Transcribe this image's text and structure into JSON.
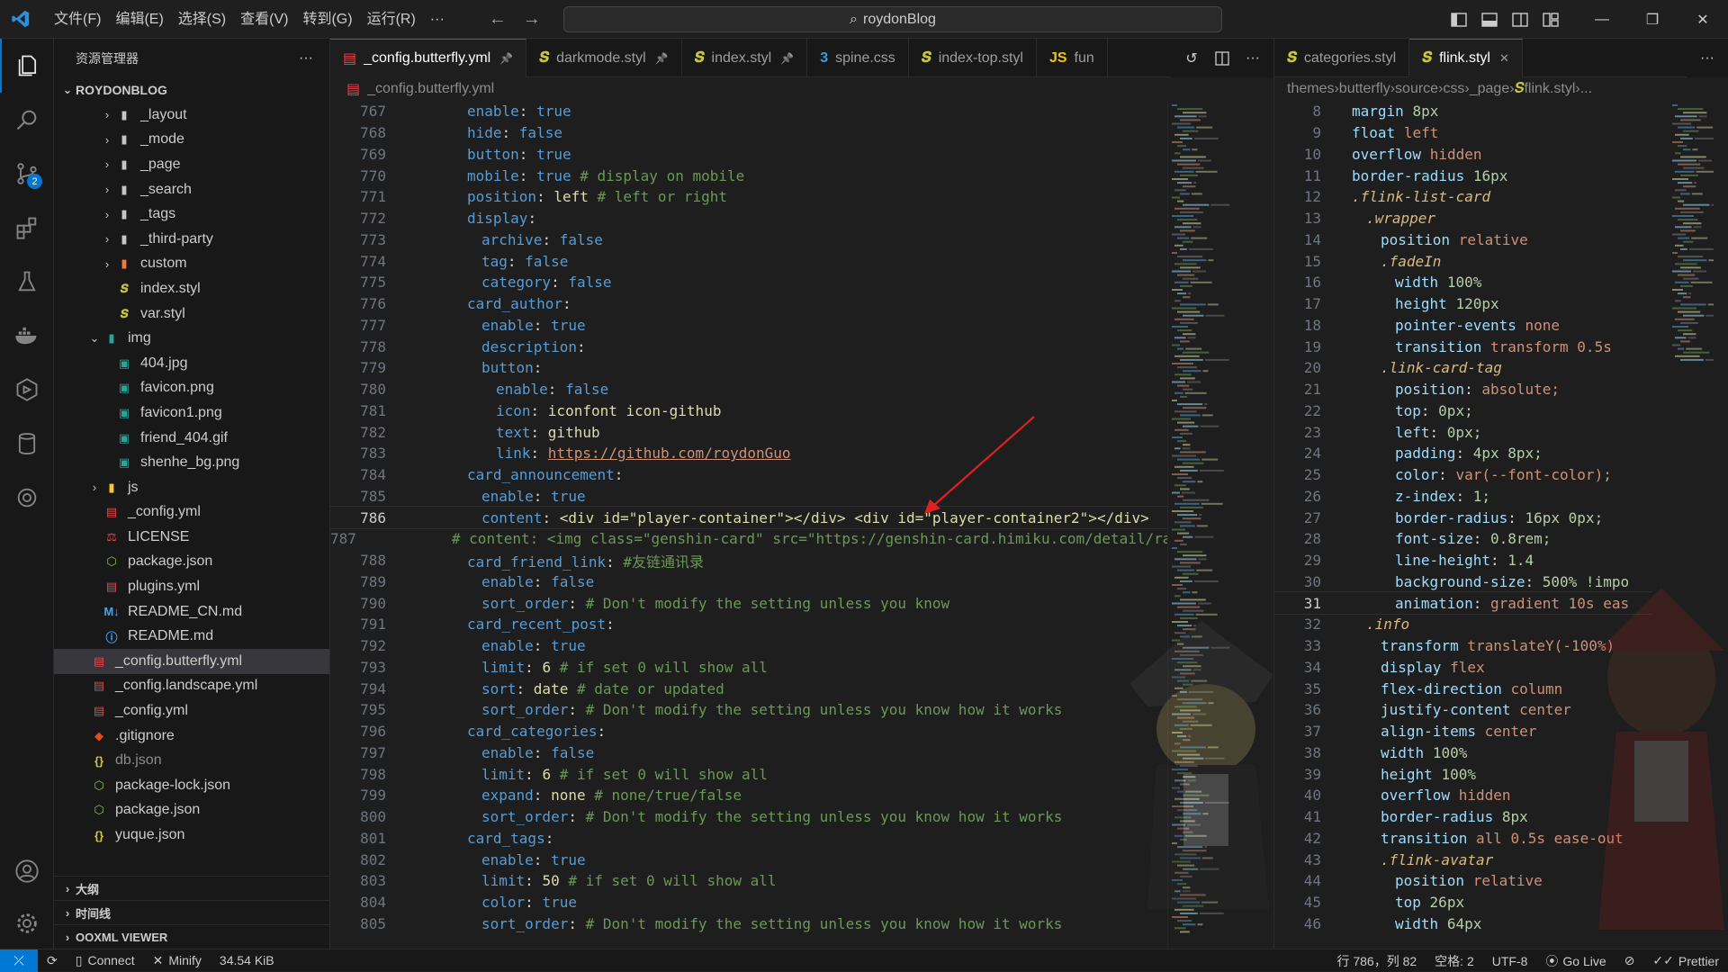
{
  "title_bar": {
    "menus": [
      "文件(F)",
      "编辑(E)",
      "选择(S)",
      "查看(V)",
      "转到(G)",
      "运行(R)",
      "···"
    ],
    "search_text": "roydonBlog"
  },
  "activity_bar": {
    "source_control_badge": "2"
  },
  "sidebar": {
    "header": "资源管理器",
    "more": "···",
    "root": "ROYDONBLOG",
    "items": [
      {
        "label": "_layout",
        "type": "folder",
        "depth": 2,
        "expanded": false
      },
      {
        "label": "_mode",
        "type": "folder",
        "depth": 2,
        "expanded": false
      },
      {
        "label": "_page",
        "type": "folder",
        "depth": 2,
        "expanded": false
      },
      {
        "label": "_search",
        "type": "folder",
        "depth": 2,
        "expanded": false
      },
      {
        "label": "_tags",
        "type": "folder",
        "depth": 2,
        "expanded": false
      },
      {
        "label": "_third-party",
        "type": "folder",
        "depth": 2,
        "expanded": false
      },
      {
        "label": "custom",
        "type": "folder-custom",
        "depth": 2,
        "expanded": false
      },
      {
        "label": "index.styl",
        "type": "styl",
        "depth": 2
      },
      {
        "label": "var.styl",
        "type": "styl",
        "depth": 2
      },
      {
        "label": "img",
        "type": "folder-img",
        "depth": 1,
        "expanded": true
      },
      {
        "label": "404.jpg",
        "type": "image",
        "depth": 2
      },
      {
        "label": "favicon.png",
        "type": "image",
        "depth": 2
      },
      {
        "label": "favicon1.png",
        "type": "image",
        "depth": 2
      },
      {
        "label": "friend_404.gif",
        "type": "image",
        "depth": 2
      },
      {
        "label": "shenhe_bg.png",
        "type": "image",
        "depth": 2
      },
      {
        "label": "js",
        "type": "folder-js",
        "depth": 1,
        "expanded": false
      },
      {
        "label": "_config.yml",
        "type": "yml",
        "depth": 1
      },
      {
        "label": "LICENSE",
        "type": "license",
        "depth": 1
      },
      {
        "label": "package.json",
        "type": "json-node",
        "depth": 1
      },
      {
        "label": "plugins.yml",
        "type": "yml",
        "depth": 1
      },
      {
        "label": "README_CN.md",
        "type": "md",
        "depth": 1
      },
      {
        "label": "README.md",
        "type": "info",
        "depth": 1
      },
      {
        "label": "_config.butterfly.yml",
        "type": "yml",
        "depth": 0,
        "selected": true
      },
      {
        "label": "_config.landscape.yml",
        "type": "yml",
        "depth": 0
      },
      {
        "label": "_config.yml",
        "type": "yml",
        "depth": 0
      },
      {
        "label": ".gitignore",
        "type": "git",
        "depth": 0
      },
      {
        "label": "db.json",
        "type": "json",
        "depth": 0,
        "dim": true
      },
      {
        "label": "package-lock.json",
        "type": "json-node",
        "depth": 0
      },
      {
        "label": "package.json",
        "type": "json-node",
        "depth": 0
      },
      {
        "label": "yuque.json",
        "type": "json",
        "depth": 0
      }
    ],
    "sections": [
      "大纲",
      "时间线",
      "OOXML VIEWER"
    ]
  },
  "editor_left": {
    "tabs": [
      {
        "label": "_config.butterfly.yml",
        "icon": "yml",
        "active": true,
        "pinned": true
      },
      {
        "label": "darkmode.styl",
        "icon": "styl",
        "pinned": true
      },
      {
        "label": "index.styl",
        "icon": "styl",
        "pinned": true
      },
      {
        "label": "spine.css",
        "icon": "css"
      },
      {
        "label": "index-top.styl",
        "icon": "styl"
      },
      {
        "label": "fun",
        "icon": "js"
      }
    ],
    "breadcrumb": "_config.butterfly.yml",
    "current_line": 786,
    "lines": [
      {
        "n": 767,
        "ind": 0,
        "k": "enable",
        "v": "true",
        "c": ""
      },
      {
        "n": 768,
        "ind": 0,
        "k": "hide",
        "v": "false",
        "c": ""
      },
      {
        "n": 769,
        "ind": 0,
        "k": "button",
        "v": "true",
        "c": ""
      },
      {
        "n": 770,
        "ind": 0,
        "k": "mobile",
        "v": "true",
        "c": "# display on mobile"
      },
      {
        "n": 771,
        "ind": 0,
        "k": "position",
        "v": "left",
        "c": "# left or right"
      },
      {
        "n": 772,
        "ind": 0,
        "k": "display",
        "v": "",
        "c": ""
      },
      {
        "n": 773,
        "ind": 1,
        "k": "archive",
        "v": "false",
        "c": ""
      },
      {
        "n": 774,
        "ind": 1,
        "k": "tag",
        "v": "false",
        "c": ""
      },
      {
        "n": 775,
        "ind": 1,
        "k": "category",
        "v": "false",
        "c": ""
      },
      {
        "n": 776,
        "ind": 0,
        "k": "card_author",
        "v": "",
        "c": ""
      },
      {
        "n": 777,
        "ind": 1,
        "k": "enable",
        "v": "true",
        "c": ""
      },
      {
        "n": 778,
        "ind": 1,
        "k": "description",
        "v": "",
        "c": ""
      },
      {
        "n": 779,
        "ind": 1,
        "k": "button",
        "v": "",
        "c": ""
      },
      {
        "n": 780,
        "ind": 2,
        "k": "enable",
        "v": "false",
        "c": ""
      },
      {
        "n": 781,
        "ind": 2,
        "k": "icon",
        "v": "iconfont icon-github",
        "c": ""
      },
      {
        "n": 782,
        "ind": 2,
        "k": "text",
        "v": "github",
        "c": ""
      },
      {
        "n": 783,
        "ind": 2,
        "k": "link",
        "v": "https://github.com/roydonGuo",
        "c": "",
        "link": true
      },
      {
        "n": 784,
        "ind": 0,
        "k": "card_announcement",
        "v": "",
        "c": ""
      },
      {
        "n": 785,
        "ind": 1,
        "k": "enable",
        "v": "true",
        "c": ""
      },
      {
        "n": 786,
        "ind": 1,
        "k": "content",
        "v": "<div id=\"player-container\"></div> <div id=\"player-container2\"></div>",
        "c": ""
      },
      {
        "n": 787,
        "ind": 1,
        "k": "",
        "v": "",
        "c": "# content: <img class=\"genshin-card\" src=\"https://genshin-card.himiku.com/detail/ra"
      },
      {
        "n": 788,
        "ind": 0,
        "k": "card_friend_link",
        "v": "",
        "c": "#友链通讯录"
      },
      {
        "n": 789,
        "ind": 1,
        "k": "enable",
        "v": "false",
        "c": ""
      },
      {
        "n": 790,
        "ind": 1,
        "k": "sort_order",
        "v": "",
        "c": "# Don't modify the setting unless you know"
      },
      {
        "n": 791,
        "ind": 0,
        "k": "card_recent_post",
        "v": "",
        "c": ""
      },
      {
        "n": 792,
        "ind": 1,
        "k": "enable",
        "v": "true",
        "c": ""
      },
      {
        "n": 793,
        "ind": 1,
        "k": "limit",
        "v": "6",
        "c": "# if set 0 will show all"
      },
      {
        "n": 794,
        "ind": 1,
        "k": "sort",
        "v": "date",
        "c": "# date or updated"
      },
      {
        "n": 795,
        "ind": 1,
        "k": "sort_order",
        "v": "",
        "c": "# Don't modify the setting unless you know how it works"
      },
      {
        "n": 796,
        "ind": 0,
        "k": "card_categories",
        "v": "",
        "c": ""
      },
      {
        "n": 797,
        "ind": 1,
        "k": "enable",
        "v": "false",
        "c": ""
      },
      {
        "n": 798,
        "ind": 1,
        "k": "limit",
        "v": "6",
        "c": "# if set 0 will show all"
      },
      {
        "n": 799,
        "ind": 1,
        "k": "expand",
        "v": "none",
        "c": "# none/true/false"
      },
      {
        "n": 800,
        "ind": 1,
        "k": "sort_order",
        "v": "",
        "c": "# Don't modify the setting unless you know how it works"
      },
      {
        "n": 801,
        "ind": 0,
        "k": "card_tags",
        "v": "",
        "c": ""
      },
      {
        "n": 802,
        "ind": 1,
        "k": "enable",
        "v": "true",
        "c": ""
      },
      {
        "n": 803,
        "ind": 1,
        "k": "limit",
        "v": "50",
        "c": "# if set 0 will show all"
      },
      {
        "n": 804,
        "ind": 1,
        "k": "color",
        "v": "true",
        "c": ""
      },
      {
        "n": 805,
        "ind": 1,
        "k": "sort_order",
        "v": "",
        "c": "# Don't modify the setting unless you know how it works"
      }
    ]
  },
  "editor_right": {
    "tabs": [
      {
        "label": "categories.styl",
        "icon": "styl",
        "active": false
      },
      {
        "label": "flink.styl",
        "icon": "styl",
        "active": true,
        "closable": true
      }
    ],
    "breadcrumb": [
      "themes",
      "butterfly",
      "source",
      "css",
      "_page",
      "flink.styl",
      "..."
    ],
    "current_line": 31,
    "lines": [
      {
        "n": 8,
        "ind": 1,
        "t": "prop",
        "p": "margin",
        "v": "8px",
        "sep": " "
      },
      {
        "n": 9,
        "ind": 1,
        "t": "prop",
        "p": "float",
        "v": "left",
        "sep": " "
      },
      {
        "n": 10,
        "ind": 1,
        "t": "prop",
        "p": "overflow",
        "v": "hidden",
        "sep": " "
      },
      {
        "n": 11,
        "ind": 1,
        "t": "prop",
        "p": "border-radius",
        "v": "16px",
        "sep": " "
      },
      {
        "n": 12,
        "ind": 1,
        "t": "sel",
        "s": ".flink-list-card"
      },
      {
        "n": 13,
        "ind": 2,
        "t": "sel",
        "s": ".wrapper"
      },
      {
        "n": 14,
        "ind": 3,
        "t": "prop",
        "p": "position",
        "v": "relative",
        "sep": " "
      },
      {
        "n": 15,
        "ind": 3,
        "t": "sel",
        "s": ".fadeIn"
      },
      {
        "n": 16,
        "ind": 4,
        "t": "prop",
        "p": "width",
        "v": "100%",
        "sep": " "
      },
      {
        "n": 17,
        "ind": 4,
        "t": "prop",
        "p": "height",
        "v": "120px",
        "sep": " "
      },
      {
        "n": 18,
        "ind": 4,
        "t": "prop",
        "p": "pointer-events",
        "v": "none",
        "sep": " "
      },
      {
        "n": 19,
        "ind": 4,
        "t": "prop",
        "p": "transition",
        "v": "transform 0.5s",
        "sep": " "
      },
      {
        "n": 20,
        "ind": 3,
        "t": "sel",
        "s": ".link-card-tag"
      },
      {
        "n": 21,
        "ind": 4,
        "t": "prop",
        "p": "position",
        "v": "absolute;",
        "sep": ": "
      },
      {
        "n": 22,
        "ind": 4,
        "t": "prop",
        "p": "top",
        "v": "0px;",
        "sep": ": "
      },
      {
        "n": 23,
        "ind": 4,
        "t": "prop",
        "p": "left",
        "v": "0px;",
        "sep": ": "
      },
      {
        "n": 24,
        "ind": 4,
        "t": "prop",
        "p": "padding",
        "v": "4px 8px;",
        "sep": ": "
      },
      {
        "n": 25,
        "ind": 4,
        "t": "prop",
        "p": "color",
        "v": "var(--font-color);",
        "sep": ": "
      },
      {
        "n": 26,
        "ind": 4,
        "t": "prop",
        "p": "z-index",
        "v": "1;",
        "sep": ": "
      },
      {
        "n": 27,
        "ind": 4,
        "t": "prop",
        "p": "border-radius",
        "v": "16px 0px;",
        "sep": ": "
      },
      {
        "n": 28,
        "ind": 4,
        "t": "prop",
        "p": "font-size",
        "v": "0.8rem;",
        "sep": ": "
      },
      {
        "n": 29,
        "ind": 4,
        "t": "prop",
        "p": "line-height",
        "v": "1.4",
        "sep": ": "
      },
      {
        "n": 30,
        "ind": 4,
        "t": "prop",
        "p": "background-size",
        "v": "500% !impo",
        "sep": ": "
      },
      {
        "n": 31,
        "ind": 4,
        "t": "prop",
        "p": "animation",
        "v": "gradient 10s eas",
        "sep": ": "
      },
      {
        "n": 32,
        "ind": 2,
        "t": "sel",
        "s": ".info"
      },
      {
        "n": 33,
        "ind": 3,
        "t": "prop",
        "p": "transform",
        "v": "translateY(-100%)",
        "sep": " "
      },
      {
        "n": 34,
        "ind": 3,
        "t": "prop",
        "p": "display",
        "v": "flex",
        "sep": " "
      },
      {
        "n": 35,
        "ind": 3,
        "t": "prop",
        "p": "flex-direction",
        "v": "column",
        "sep": " "
      },
      {
        "n": 36,
        "ind": 3,
        "t": "prop",
        "p": "justify-content",
        "v": "center",
        "sep": " "
      },
      {
        "n": 37,
        "ind": 3,
        "t": "prop",
        "p": "align-items",
        "v": "center",
        "sep": " "
      },
      {
        "n": 38,
        "ind": 3,
        "t": "prop",
        "p": "width",
        "v": "100%",
        "sep": " "
      },
      {
        "n": 39,
        "ind": 3,
        "t": "prop",
        "p": "height",
        "v": "100%",
        "sep": " "
      },
      {
        "n": 40,
        "ind": 3,
        "t": "prop",
        "p": "overflow",
        "v": "hidden",
        "sep": " "
      },
      {
        "n": 41,
        "ind": 3,
        "t": "prop",
        "p": "border-radius",
        "v": "8px",
        "sep": " "
      },
      {
        "n": 42,
        "ind": 3,
        "t": "prop",
        "p": "transition",
        "v": "all 0.5s ease-out",
        "sep": " "
      },
      {
        "n": 43,
        "ind": 3,
        "t": "sel",
        "s": ".flink-avatar"
      },
      {
        "n": 44,
        "ind": 4,
        "t": "prop",
        "p": "position",
        "v": "relative",
        "sep": " "
      },
      {
        "n": 45,
        "ind": 4,
        "t": "prop",
        "p": "top",
        "v": "26px",
        "sep": " "
      },
      {
        "n": 46,
        "ind": 4,
        "t": "prop",
        "p": "width",
        "v": "64px",
        "sep": " "
      }
    ]
  },
  "status_bar": {
    "connect": "Connect",
    "minify": "Minify",
    "size": "34.54 KiB",
    "position": "行 786，列 82",
    "spaces": "空格: 2",
    "encoding": "UTF-8",
    "go_live": "Go Live",
    "prettier": "Prettier"
  },
  "colors": {
    "accent": "#0078d4",
    "annotation_arrow": "#e02020",
    "yml_icon": "#e8454d",
    "styl_icon": "#c5c73f",
    "css_icon": "#3c9cd7"
  }
}
